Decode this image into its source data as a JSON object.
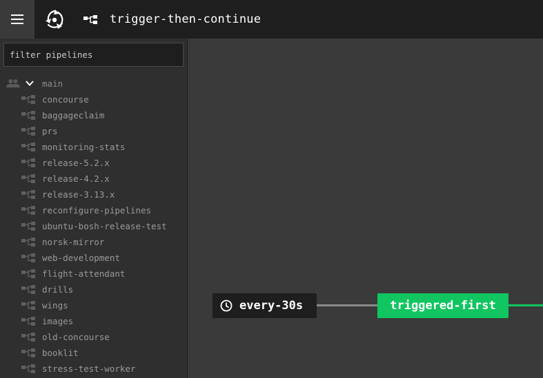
{
  "topbar": {
    "pipeline_name": "trigger-then-continue"
  },
  "sidebar": {
    "filter_placeholder": "filter pipelines",
    "team": {
      "name": "main",
      "expanded": true
    },
    "pipelines": [
      "concourse",
      "baggageclaim",
      "prs",
      "monitoring-stats",
      "release-5.2.x",
      "release-4.2.x",
      "release-3.13.x",
      "reconfigure-pipelines",
      "ubuntu-bosh-release-test",
      "norsk-mirror",
      "web-development",
      "flight-attendant",
      "drills",
      "wings",
      "images",
      "old-concourse",
      "booklit",
      "stress-test-worker"
    ]
  },
  "graph": {
    "resource": {
      "name": "every-30s",
      "icon": "clock-icon"
    },
    "job": {
      "name": "triggered-first",
      "status": "succeeded",
      "status_color": "#11c560"
    }
  },
  "colors": {
    "topbar_bg": "#1e1e1e",
    "sidebar_bg": "#2f2f2f",
    "canvas_bg": "#3a3a3a",
    "success": "#11c560"
  }
}
